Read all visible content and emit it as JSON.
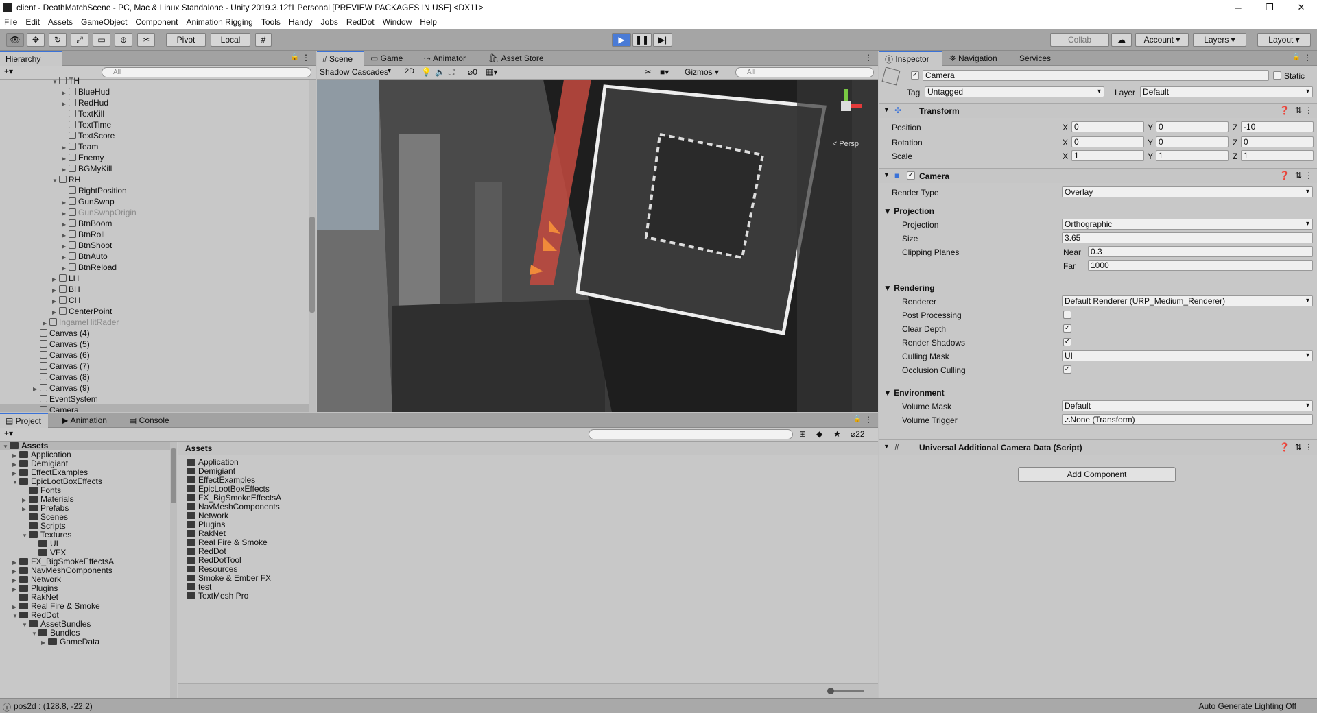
{
  "window": {
    "title": "client - DeathMatchScene - PC, Mac & Linux Standalone - Unity 2019.3.12f1 Personal [PREVIEW PACKAGES IN USE] <DX11>"
  },
  "menu": [
    "File",
    "Edit",
    "Assets",
    "GameObject",
    "Component",
    "Animation Rigging",
    "Tools",
    "Handy",
    "Jobs",
    "RedDot",
    "Window",
    "Help"
  ],
  "toolbar": {
    "pivot": "Pivot",
    "local": "Local",
    "collab": "Collab",
    "account": "Account",
    "layers": "Layers",
    "layout": "Layout"
  },
  "hierarchy": {
    "tab": "Hierarchy",
    "search_placeholder": "All",
    "items": [
      {
        "label": "TH",
        "depth": 4,
        "arrow": "open",
        "grey": false
      },
      {
        "label": "BlueHud",
        "depth": 5,
        "arrow": "closed",
        "grey": false
      },
      {
        "label": "RedHud",
        "depth": 5,
        "arrow": "closed",
        "grey": false
      },
      {
        "label": "TextKill",
        "depth": 5,
        "arrow": "none",
        "grey": false
      },
      {
        "label": "TextTime",
        "depth": 5,
        "arrow": "none",
        "grey": false
      },
      {
        "label": "TextScore",
        "depth": 5,
        "arrow": "none",
        "grey": false
      },
      {
        "label": "Team",
        "depth": 5,
        "arrow": "closed",
        "grey": false
      },
      {
        "label": "Enemy",
        "depth": 5,
        "arrow": "closed",
        "grey": false
      },
      {
        "label": "BGMyKill",
        "depth": 5,
        "arrow": "closed",
        "grey": false
      },
      {
        "label": "RH",
        "depth": 4,
        "arrow": "open",
        "grey": false
      },
      {
        "label": "RightPosition",
        "depth": 5,
        "arrow": "none",
        "grey": false
      },
      {
        "label": "GunSwap",
        "depth": 5,
        "arrow": "closed",
        "grey": false
      },
      {
        "label": "GunSwapOrigin",
        "depth": 5,
        "arrow": "closed",
        "grey": true
      },
      {
        "label": "BtnBoom",
        "depth": 5,
        "arrow": "closed",
        "grey": false
      },
      {
        "label": "BtnRoll",
        "depth": 5,
        "arrow": "closed",
        "grey": false
      },
      {
        "label": "BtnShoot",
        "depth": 5,
        "arrow": "closed",
        "grey": false
      },
      {
        "label": "BtnAuto",
        "depth": 5,
        "arrow": "closed",
        "grey": false
      },
      {
        "label": "BtnReload",
        "depth": 5,
        "arrow": "closed",
        "grey": false
      },
      {
        "label": "LH",
        "depth": 4,
        "arrow": "closed",
        "grey": false
      },
      {
        "label": "BH",
        "depth": 4,
        "arrow": "closed",
        "grey": false
      },
      {
        "label": "CH",
        "depth": 4,
        "arrow": "closed",
        "grey": false
      },
      {
        "label": "CenterPoint",
        "depth": 4,
        "arrow": "closed",
        "grey": false
      },
      {
        "label": "IngameHitRader",
        "depth": 3,
        "arrow": "closed",
        "grey": true
      },
      {
        "label": "Canvas (4)",
        "depth": 2,
        "arrow": "none",
        "grey": false
      },
      {
        "label": "Canvas (5)",
        "depth": 2,
        "arrow": "none",
        "grey": false
      },
      {
        "label": "Canvas (6)",
        "depth": 2,
        "arrow": "none",
        "grey": false
      },
      {
        "label": "Canvas (7)",
        "depth": 2,
        "arrow": "none",
        "grey": false
      },
      {
        "label": "Canvas (8)",
        "depth": 2,
        "arrow": "none",
        "grey": false
      },
      {
        "label": "Canvas (9)",
        "depth": 2,
        "arrow": "closed",
        "grey": false
      },
      {
        "label": "EventSystem",
        "depth": 2,
        "arrow": "none",
        "grey": false
      },
      {
        "label": "Camera",
        "depth": 2,
        "arrow": "none",
        "grey": false,
        "selected": true
      }
    ]
  },
  "scene": {
    "tabs": [
      "Scene",
      "Game",
      "Animator",
      "Asset Store"
    ],
    "shading": "Shadow Cascades",
    "mode2d": "2D",
    "hidden_count": "0",
    "gizmos": "Gizmos",
    "search_placeholder": "All",
    "persp": "< Persp"
  },
  "inspector": {
    "tabs": [
      "Inspector",
      "Navigation",
      "Services"
    ],
    "object_name": "Camera",
    "static_label": "Static",
    "tag_label": "Tag",
    "tag_value": "Untagged",
    "layer_label": "Layer",
    "layer_value": "Default",
    "transform": {
      "title": "Transform",
      "position": {
        "label": "Position",
        "x": "0",
        "y": "0",
        "z": "-10"
      },
      "rotation": {
        "label": "Rotation",
        "x": "0",
        "y": "0",
        "z": "0"
      },
      "scale": {
        "label": "Scale",
        "x": "1",
        "y": "1",
        "z": "1"
      }
    },
    "camera": {
      "title": "Camera",
      "render_type_label": "Render Type",
      "render_type": "Overlay",
      "projection_header": "Projection",
      "projection_label": "Projection",
      "projection": "Orthographic",
      "size_label": "Size",
      "size": "3.65",
      "clipping_label": "Clipping Planes",
      "near_label": "Near",
      "near": "0.3",
      "far_label": "Far",
      "far": "1000",
      "rendering_header": "Rendering",
      "renderer_label": "Renderer",
      "renderer": "Default Renderer (URP_Medium_Renderer)",
      "post_label": "Post Processing",
      "post": false,
      "clear_depth_label": "Clear Depth",
      "clear_depth": true,
      "shadows_label": "Render Shadows",
      "shadows": true,
      "culling_label": "Culling Mask",
      "culling": "UI",
      "occlusion_label": "Occlusion Culling",
      "occlusion": true,
      "environment_header": "Environment",
      "volume_mask_label": "Volume Mask",
      "volume_mask": "Default",
      "volume_trigger_label": "Volume Trigger",
      "volume_trigger": "None (Transform)"
    },
    "additional": "Universal Additional Camera Data (Script)",
    "add_component": "Add Component"
  },
  "project": {
    "tabs": [
      "Project",
      "Animation",
      "Console"
    ],
    "hidden_count": "22",
    "tree": [
      {
        "label": "Assets",
        "depth": 0,
        "arrow": "open",
        "bold": true
      },
      {
        "label": "Application",
        "depth": 1,
        "arrow": "closed"
      },
      {
        "label": "Demigiant",
        "depth": 1,
        "arrow": "closed"
      },
      {
        "label": "EffectExamples",
        "depth": 1,
        "arrow": "closed"
      },
      {
        "label": "EpicLootBoxEffects",
        "depth": 1,
        "arrow": "open"
      },
      {
        "label": "Fonts",
        "depth": 2,
        "arrow": "none"
      },
      {
        "label": "Materials",
        "depth": 2,
        "arrow": "closed"
      },
      {
        "label": "Prefabs",
        "depth": 2,
        "arrow": "closed"
      },
      {
        "label": "Scenes",
        "depth": 2,
        "arrow": "none"
      },
      {
        "label": "Scripts",
        "depth": 2,
        "arrow": "none"
      },
      {
        "label": "Textures",
        "depth": 2,
        "arrow": "open"
      },
      {
        "label": "UI",
        "depth": 3,
        "arrow": "none"
      },
      {
        "label": "VFX",
        "depth": 3,
        "arrow": "none"
      },
      {
        "label": "FX_BigSmokeEffectsA",
        "depth": 1,
        "arrow": "closed"
      },
      {
        "label": "NavMeshComponents",
        "depth": 1,
        "arrow": "closed"
      },
      {
        "label": "Network",
        "depth": 1,
        "arrow": "closed"
      },
      {
        "label": "Plugins",
        "depth": 1,
        "arrow": "closed"
      },
      {
        "label": "RakNet",
        "depth": 1,
        "arrow": "none"
      },
      {
        "label": "Real Fire & Smoke",
        "depth": 1,
        "arrow": "closed"
      },
      {
        "label": "RedDot",
        "depth": 1,
        "arrow": "open"
      },
      {
        "label": "AssetBundles",
        "depth": 2,
        "arrow": "open"
      },
      {
        "label": "Bundles",
        "depth": 3,
        "arrow": "open"
      },
      {
        "label": "GameData",
        "depth": 4,
        "arrow": "closed"
      }
    ],
    "assets_header": "Assets",
    "assets": [
      "Application",
      "Demigiant",
      "EffectExamples",
      "EpicLootBoxEffects",
      "FX_BigSmokeEffectsA",
      "NavMeshComponents",
      "Network",
      "Plugins",
      "RakNet",
      "Real Fire & Smoke",
      "RedDot",
      "RedDotTool",
      "Resources",
      "Smoke & Ember FX",
      "test",
      "TextMesh Pro"
    ]
  },
  "status": {
    "left": "pos2d : (128.8, -22.2)",
    "right": "Auto Generate Lighting Off"
  },
  "colors": {
    "accent": "#3a72d8",
    "play": "#4a7bd6"
  }
}
